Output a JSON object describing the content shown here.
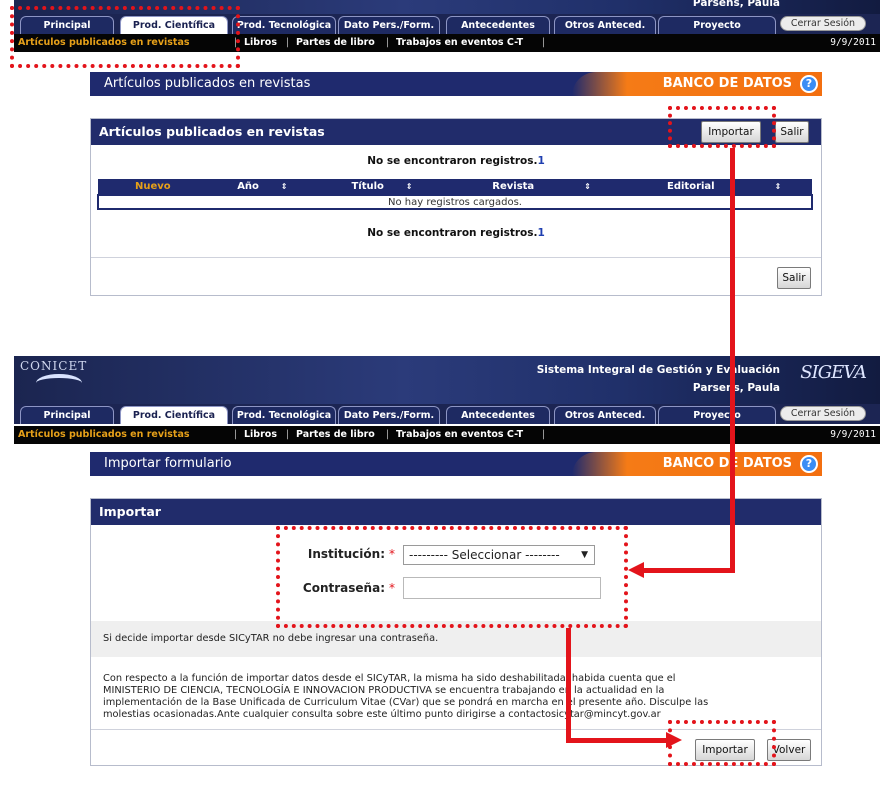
{
  "top_panel": {
    "banner_user": "Parsens, Paula",
    "tabs": [
      "Principal",
      "Prod. Científica",
      "Prod. Tecnológica",
      "Dato Pers./Form.",
      "Antecedentes",
      "Otros Anteced.",
      "Proyecto"
    ],
    "logout_label": "Cerrar Sesión",
    "subnav": {
      "active": "Artículos publicados en revistas",
      "items": [
        "Libros",
        "Partes de libro",
        "Trabajos en eventos C-T"
      ],
      "separator": "|"
    },
    "date": "9/9/2011",
    "page_title": "Artículos publicados en revistas",
    "banco_label": "BANCO DE DATOS",
    "help_glyph": "?",
    "box_title": "Artículos publicados en revistas",
    "import_label": "Importar",
    "exit_label": "Salir",
    "no_records_text": "No se encontraron registros.",
    "no_records_count": "1",
    "table_headers": [
      "Nuevo",
      "Año",
      "Título",
      "Revista",
      "Editorial"
    ],
    "sort_glyph": "⇕",
    "empty_row_text": "No hay registros cargados.",
    "footer_exit_label": "Salir"
  },
  "bottom_panel": {
    "brand": "CONICET",
    "system_name": "Sistema Integral de Gestión y Evaluación",
    "user_name": "Parsens, Paula",
    "logo_text": "SIGEVA",
    "tabs": [
      "Principal",
      "Prod. Científica",
      "Prod. Tecnológica",
      "Dato Pers./Form.",
      "Antecedentes",
      "Otros Anteced.",
      "Proyecto"
    ],
    "logout_label": "Cerrar Sesión",
    "subnav": {
      "active": "Artículos publicados en revistas",
      "items": [
        "Libros",
        "Partes de libro",
        "Trabajos en eventos C-T"
      ],
      "separator": "|"
    },
    "date": "9/9/2011",
    "page_title": "Importar formulario",
    "banco_label": "BANCO DE DATOS",
    "help_glyph": "?",
    "box_title": "Importar",
    "institucion_label": "Institución:",
    "required_mark": "*",
    "select_value": "--------- Seleccionar --------",
    "select_caret": "▼",
    "password_label": "Contraseña:",
    "password_value": "",
    "sicytar_note": "Si decide importar desde SICyTAR no debe ingresar una contraseña.",
    "disclaimer_lines": [
      "Con respecto a la función de importar datos desde el SICyTAR, la misma ha sido deshabilitada, habida cuenta que el",
      "MINISTERIO DE CIENCIA, TECNOLOGÍA E INNOVACION PRODUCTIVA se encuentra trabajando en la actualidad en la",
      "implementación de la Base Unificada de Curriculum Vitae (CVar) que se pondrá en marcha en el presente año. Disculpe las",
      "molestias ocasionadas.Ante cualquier consulta sobre este último punto dirigirse a contactosicytar@mincyt.gov.ar"
    ],
    "import_label": "Importar",
    "back_label": "Volver"
  },
  "annotation_color": "#e3141b",
  "theme": {
    "navy": "#1f2a6e",
    "orange": "#f36f10",
    "active_link": "#e6a019"
  }
}
